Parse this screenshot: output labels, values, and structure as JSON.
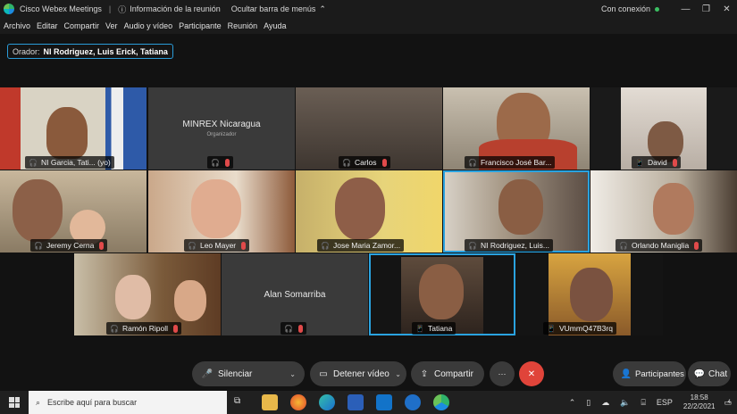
{
  "titlebar": {
    "app_title": "Cisco Webex Meetings",
    "meeting_info": "Información de la reunión",
    "hide_menu": "Ocultar barra de menús",
    "connection": "Con conexión"
  },
  "menu": [
    "Archivo",
    "Editar",
    "Compartir",
    "Ver",
    "Audio y vídeo",
    "Participante",
    "Reunión",
    "Ayuda"
  ],
  "speaker": {
    "prefix": "Orador:",
    "names": "NI Rodriguez, Luis Erick, Tatiana"
  },
  "participants": [
    {
      "name": "NI Garcia, Tati... (yo)",
      "icon": "headset-icon"
    },
    {
      "name": "MINREX Nicaragua",
      "role": "Organizador",
      "icon": "headset-icon"
    },
    {
      "name": "Carlos",
      "icon": "headset-icon"
    },
    {
      "name": "Francisco José Bar...",
      "icon": "headset-icon"
    },
    {
      "name": "David",
      "icon": "phone-icon"
    },
    {
      "name": "Jeremy Cerna",
      "icon": "headset-icon"
    },
    {
      "name": "Leo Mayer",
      "icon": "headset-icon"
    },
    {
      "name": "Jose Maria Zamor...",
      "icon": "headset-icon"
    },
    {
      "name": "NI Rodriguez, Luis...",
      "icon": "headset-icon"
    },
    {
      "name": "Orlando Maniglia",
      "icon": "headset-icon"
    },
    {
      "name": "Ramón Ripoll",
      "icon": "headset-icon"
    },
    {
      "name": "Alan Somarriba",
      "icon": "headset-icon"
    },
    {
      "name": "Tatiana",
      "icon": "phone-icon"
    },
    {
      "name": "VUmmQ47B3rq",
      "icon": "phone-icon"
    }
  ],
  "controls": {
    "mute": "Silenciar",
    "stop_video": "Detener vídeo",
    "share": "Compartir",
    "more": "···",
    "end": "✕",
    "participants": "Participantes",
    "chat": "Chat"
  },
  "taskbar": {
    "search_placeholder": "Escribe aquí para buscar",
    "language": "ESP",
    "time": "18:58",
    "date": "22/2/2021",
    "notifications": "4"
  },
  "colors": {
    "accent": "#2aa3e0",
    "mute_icon": "#3bbf62",
    "end_button": "#e0443a",
    "muted_mic": "#e04a4a"
  }
}
